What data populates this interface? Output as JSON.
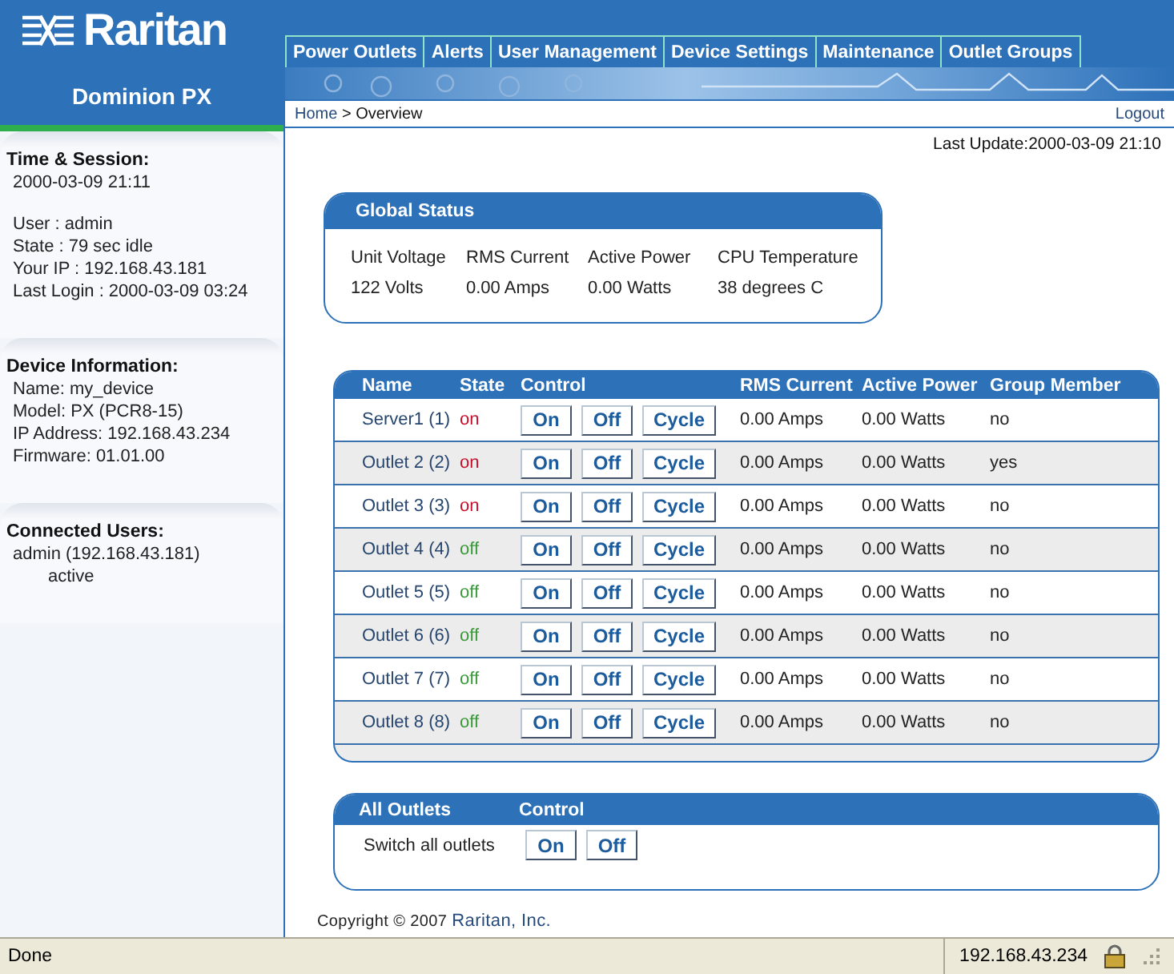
{
  "header": {
    "logo": "Raritan",
    "product": "Dominion PX"
  },
  "tabs": [
    {
      "label": "Power Outlets"
    },
    {
      "label": "Alerts"
    },
    {
      "label": "User Management"
    },
    {
      "label": "Device Settings"
    },
    {
      "label": "Maintenance"
    },
    {
      "label": "Outlet Groups"
    }
  ],
  "breadcrumb": {
    "home": "Home",
    "separator": ">",
    "current": "Overview"
  },
  "logout": "Logout",
  "last_update": "Last Update:2000-03-09 21:10",
  "sidebar": {
    "sections": [
      {
        "title": "Time & Session:",
        "groups": [
          [
            "2000-03-09 21:11"
          ],
          [
            "User : admin",
            "State : 79 sec idle",
            "Your IP : 192.168.43.181",
            "Last Login : 2000-03-09 03:24"
          ]
        ]
      },
      {
        "title": "Device Information:",
        "groups": [
          [
            "Name: my_device",
            "Model: PX (PCR8-15)",
            "IP Address: 192.168.43.234",
            "Firmware: 01.01.00"
          ]
        ]
      },
      {
        "title": "Connected Users:",
        "users": [
          {
            "name": "admin (192.168.43.181)",
            "status": "active"
          }
        ]
      }
    ]
  },
  "global_status": {
    "title": "Global Status",
    "items": [
      {
        "label": "Unit Voltage",
        "value": "122 Volts"
      },
      {
        "label": "RMS Current",
        "value": "0.00 Amps"
      },
      {
        "label": "Active Power",
        "value": "0.00 Watts"
      },
      {
        "label": "CPU Temperature",
        "value": "38 degrees C"
      }
    ]
  },
  "outlets": {
    "columns": [
      "Name",
      "State",
      "Control",
      "RMS Current",
      "Active Power",
      "Group Member"
    ],
    "rows": [
      {
        "name": "Server1 (1)",
        "state": "on",
        "on": true,
        "buttons": [
          "On",
          "Off",
          "Cycle"
        ],
        "current": "0.00 Amps",
        "power": "0.00 Watts",
        "group": "no"
      },
      {
        "name": "Outlet 2 (2)",
        "state": "on",
        "on": true,
        "buttons": [
          "On",
          "Off",
          "Cycle"
        ],
        "current": "0.00 Amps",
        "power": "0.00 Watts",
        "group": "yes"
      },
      {
        "name": "Outlet 3 (3)",
        "state": "on",
        "on": true,
        "buttons": [
          "On",
          "Off",
          "Cycle"
        ],
        "current": "0.00 Amps",
        "power": "0.00 Watts",
        "group": "no"
      },
      {
        "name": "Outlet 4 (4)",
        "state": "off",
        "on": false,
        "buttons": [
          "On",
          "Off",
          "Cycle"
        ],
        "current": "0.00 Amps",
        "power": "0.00 Watts",
        "group": "no"
      },
      {
        "name": "Outlet 5 (5)",
        "state": "off",
        "on": false,
        "buttons": [
          "On",
          "Off",
          "Cycle"
        ],
        "current": "0.00 Amps",
        "power": "0.00 Watts",
        "group": "no"
      },
      {
        "name": "Outlet 6 (6)",
        "state": "off",
        "on": false,
        "buttons": [
          "On",
          "Off",
          "Cycle"
        ],
        "current": "0.00 Amps",
        "power": "0.00 Watts",
        "group": "no"
      },
      {
        "name": "Outlet 7 (7)",
        "state": "off",
        "on": false,
        "buttons": [
          "On",
          "Off",
          "Cycle"
        ],
        "current": "0.00 Amps",
        "power": "0.00 Watts",
        "group": "no"
      },
      {
        "name": "Outlet 8 (8)",
        "state": "off",
        "on": false,
        "buttons": [
          "On",
          "Off",
          "Cycle"
        ],
        "current": "0.00 Amps",
        "power": "0.00 Watts",
        "group": "no"
      }
    ]
  },
  "all_outlets": {
    "columns": [
      "All Outlets",
      "Control"
    ],
    "label": "Switch all outlets",
    "buttons": [
      "On",
      "Off"
    ]
  },
  "copyright": {
    "text": "Copyright © 2007 ",
    "link": "Raritan, Inc."
  },
  "status_bar": {
    "status": "Done",
    "address": "192.168.43.234"
  }
}
